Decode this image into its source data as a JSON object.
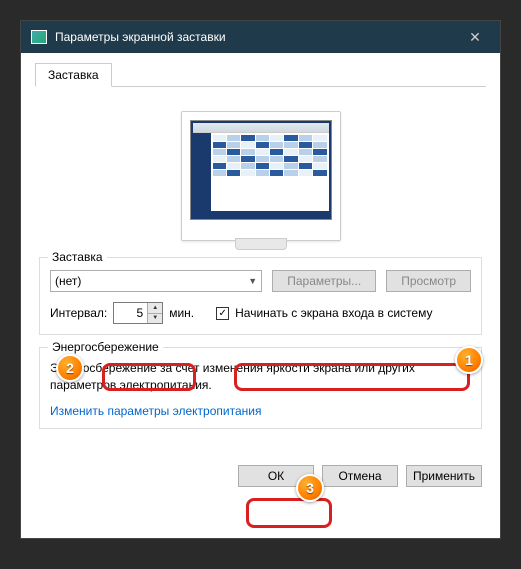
{
  "window": {
    "title": "Параметры экранной заставки"
  },
  "tab": {
    "label": "Заставка"
  },
  "screensaver": {
    "group_label": "Заставка",
    "select_value": "(нет)",
    "params_btn": "Параметры...",
    "preview_btn": "Просмотр",
    "interval_label": "Интервал:",
    "interval_value": "5",
    "interval_unit": "мин.",
    "resume_checked": true,
    "resume_label": "Начинать с экрана входа в систему"
  },
  "power": {
    "group_label": "Энергосбережение",
    "desc": "Энергосбережение за счет изменения яркости экрана или других параметров электропитания.",
    "link": "Изменить параметры электропитания"
  },
  "buttons": {
    "ok": "ОК",
    "cancel": "Отмена",
    "apply": "Применить"
  },
  "badges": {
    "b1": "1",
    "b2": "2",
    "b3": "3"
  }
}
